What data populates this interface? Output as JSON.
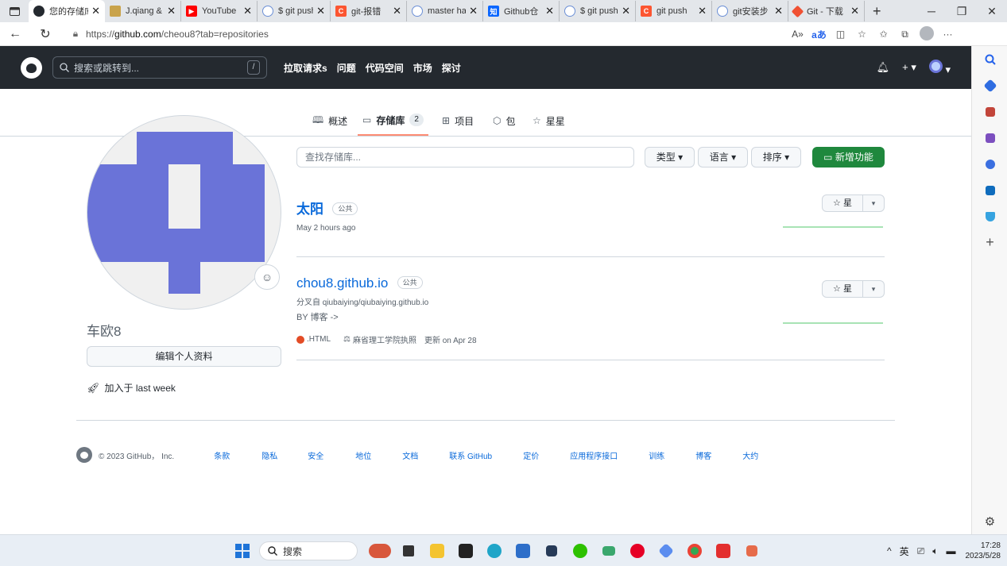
{
  "browser": {
    "tabs": [
      {
        "title": "您的存储库",
        "icon": "github-icon",
        "color": "#24292f",
        "active": true
      },
      {
        "title": "J.qiang &",
        "icon": "user-icon",
        "color": "#c9a34b"
      },
      {
        "title": "YouTube",
        "icon": "youtube-icon",
        "color": "#ff0000"
      },
      {
        "title": "$ git push",
        "icon": "search-icon",
        "color": "#6b8fd6"
      },
      {
        "title": "git-报错",
        "icon": "csdn-icon",
        "color": "#fc5531"
      },
      {
        "title": "master ha",
        "icon": "search-icon",
        "color": "#6b8fd6"
      },
      {
        "title": "Github仓",
        "icon": "zhihu-icon",
        "color": "#0a66ff"
      },
      {
        "title": "$ git push",
        "icon": "search-icon",
        "color": "#6b8fd6"
      },
      {
        "title": "git push",
        "icon": "csdn-icon",
        "color": "#fc5531"
      },
      {
        "title": "git安装步",
        "icon": "search-icon",
        "color": "#6b8fd6"
      },
      {
        "title": "Git - 下载",
        "icon": "git-icon",
        "color": "#f05133"
      }
    ],
    "url_prefix": "https://",
    "url_host": "github.com",
    "url_path": "/cheou8?tab=repositories"
  },
  "github": {
    "search_placeholder": "搜索或跳转到...",
    "search_key": "/",
    "nav": [
      "拉取请求s",
      "问题",
      "代码空间",
      "市场",
      "探讨"
    ],
    "profile_tabs": [
      {
        "label": "概述",
        "icon": "book-icon"
      },
      {
        "label": "存储库",
        "icon": "repo-icon",
        "count": "2"
      },
      {
        "label": "项目",
        "icon": "table-icon"
      },
      {
        "label": "包",
        "icon": "package-icon"
      },
      {
        "label": "星星",
        "icon": "star-icon"
      }
    ],
    "user": {
      "name": "车欧8",
      "edit_label": "编辑个人资料",
      "joined": "加入于 last week"
    },
    "filter": {
      "find_placeholder": "查找存储库...",
      "type": "类型",
      "language": "语言",
      "sort": "排序",
      "new": "新增功能"
    },
    "repos": [
      {
        "name": "太阳",
        "visibility": "公共",
        "updated": "May 2 hours ago",
        "star_label": "星"
      },
      {
        "name": "chou8.github.io",
        "visibility": "公共",
        "forked_from": "分叉自 qiubaiying/qiubaiying.github.io",
        "description": "BY 博客 ->",
        "language": ".HTML",
        "license": "麻省理工学院执照",
        "updated": "更新 on Apr 28",
        "star_label": "星"
      }
    ],
    "footer": {
      "copyright": "© 2023 GitHub， Inc.",
      "links": [
        "条款",
        "隐私",
        "安全",
        "地位",
        "文档",
        "联系 GitHub",
        "定价",
        "应用程序接口",
        "训练",
        "博客",
        "大约"
      ]
    }
  },
  "taskbar": {
    "search": "搜索",
    "ime": "英",
    "time": "17:28",
    "date": "2023/5/28"
  }
}
